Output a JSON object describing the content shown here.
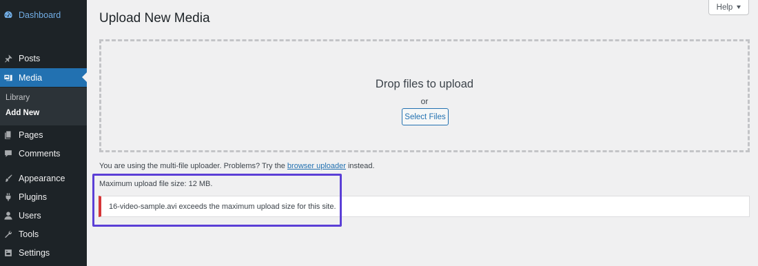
{
  "sidebar": {
    "items": [
      {
        "key": "dashboard",
        "label": "Dashboard",
        "icon": "dashboard-icon"
      },
      {
        "key": "posts",
        "label": "Posts",
        "icon": "pin-icon"
      },
      {
        "key": "media",
        "label": "Media",
        "icon": "media-icon"
      },
      {
        "key": "pages",
        "label": "Pages",
        "icon": "pages-icon"
      },
      {
        "key": "comments",
        "label": "Comments",
        "icon": "comment-icon"
      },
      {
        "key": "appearance",
        "label": "Appearance",
        "icon": "paintbrush-icon"
      },
      {
        "key": "plugins",
        "label": "Plugins",
        "icon": "plugin-icon"
      },
      {
        "key": "users",
        "label": "Users",
        "icon": "user-icon"
      },
      {
        "key": "tools",
        "label": "Tools",
        "icon": "wrench-icon"
      },
      {
        "key": "settings",
        "label": "Settings",
        "icon": "settings-icon"
      }
    ],
    "submenu": [
      {
        "label": "Library"
      },
      {
        "label": "Add New"
      }
    ]
  },
  "header": {
    "title": "Upload New Media",
    "help_label": "Help"
  },
  "dropzone": {
    "drop_text": "Drop files to upload",
    "or_text": "or",
    "button_label": "Select Files"
  },
  "uploader_note": {
    "before": "You are using the multi-file uploader. Problems? Try the ",
    "link": "browser uploader",
    "after": " instead."
  },
  "max_size_text": "Maximum upload file size: 12 MB.",
  "error_text": "16-video-sample.avi exceeds the maximum upload size for this site.",
  "colors": {
    "sidebar_bg": "#1d2327",
    "active_bg": "#2271b1",
    "error_border": "#d63638",
    "highlight": "#5b3fd6"
  }
}
